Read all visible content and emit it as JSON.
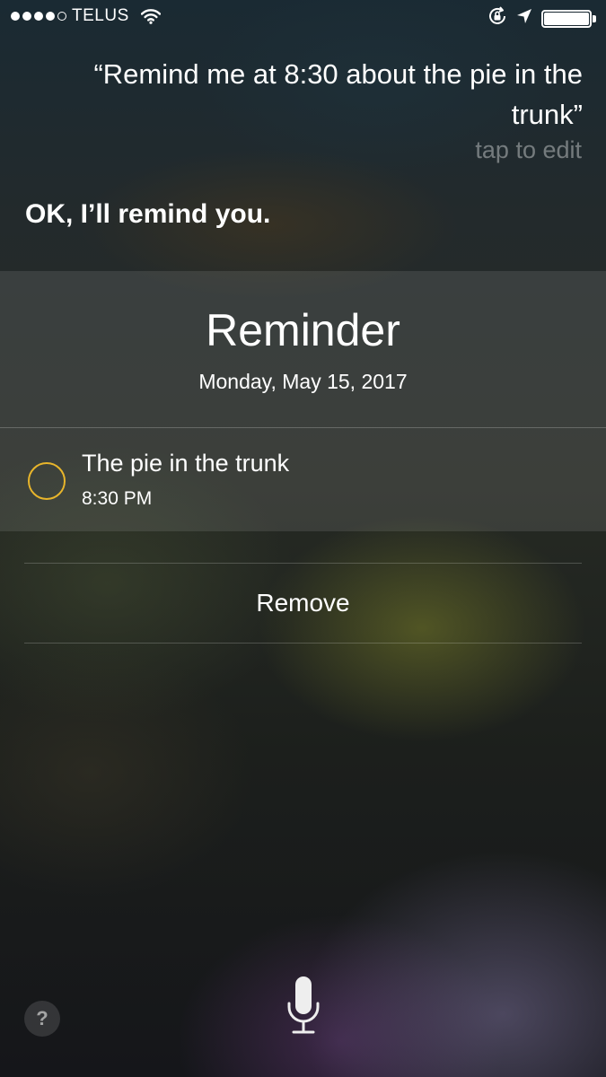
{
  "status_bar": {
    "signal_bars_filled": 4,
    "signal_bars_total": 5,
    "carrier": "TELUS",
    "icons": [
      "wifi-icon",
      "rotation-lock-icon",
      "location-arrow-icon",
      "battery-icon"
    ],
    "battery_level_fraction": 1.0
  },
  "siri": {
    "query": "“Remind me at 8:30 about the pie in the trunk”",
    "tap_to_edit": "tap to edit",
    "response": "OK, I’ll remind you."
  },
  "reminder_card": {
    "title": "Reminder",
    "date": "Monday, May 15, 2017",
    "item": {
      "title": "The pie in the trunk",
      "time": "8:30 PM",
      "checkbox_color": "#e8b52b"
    }
  },
  "actions": {
    "remove_label": "Remove"
  },
  "bottom": {
    "help_label": "?",
    "mic_icon": "microphone-icon"
  }
}
